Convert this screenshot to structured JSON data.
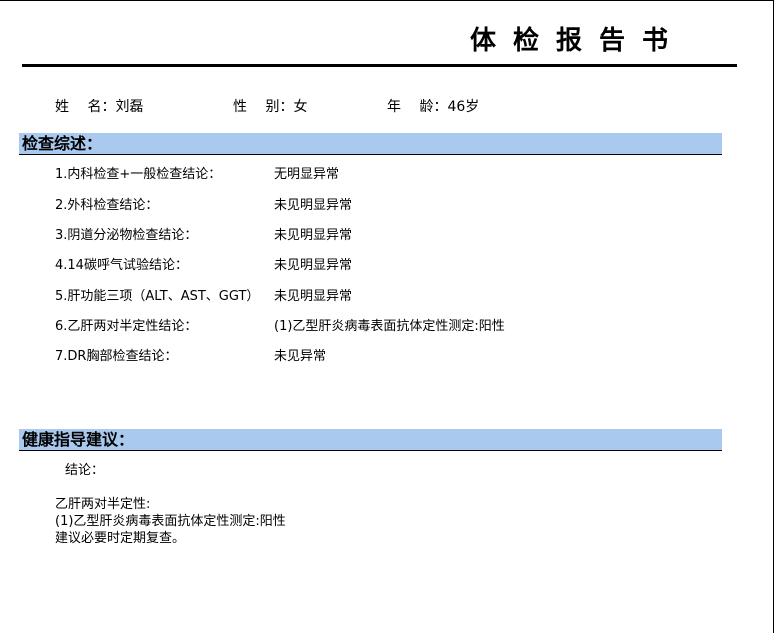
{
  "report": {
    "title": "体检报告书"
  },
  "patient": {
    "name_label": "姓　 名：",
    "name_value": "刘磊",
    "gender_label": "性　 别：",
    "gender_value": "女",
    "age_label": "年　 龄：",
    "age_value": "46岁"
  },
  "summary": {
    "header": "检查综述：",
    "items": [
      {
        "label": "1.内科检查+一般检查结论：",
        "value": "无明显异常"
      },
      {
        "label": "2.外科检查结论：",
        "value": "未见明显异常"
      },
      {
        "label": "3.阴道分泌物检查结论：",
        "value": "未见明显异常"
      },
      {
        "label": "4.14碳呼气试验结论：",
        "value": "未见明显异常"
      },
      {
        "label": "5.肝功能三项（ALT、AST、GGT）",
        "value": "未见明显异常"
      },
      {
        "label": "6.乙肝两对半定性结论：",
        "value": "(1)乙型肝炎病毒表面抗体定性测定:阳性"
      },
      {
        "label": "7.DR胸部检查结论：",
        "value": "未见异常"
      }
    ]
  },
  "advice": {
    "header": "健康指导建议：",
    "conclusion_label": "结论：",
    "lines": [
      "乙肝两对半定性:",
      "(1)乙型肝炎病毒表面抗体定性测定:阳性",
      "建议必要时定期复查。"
    ]
  }
}
